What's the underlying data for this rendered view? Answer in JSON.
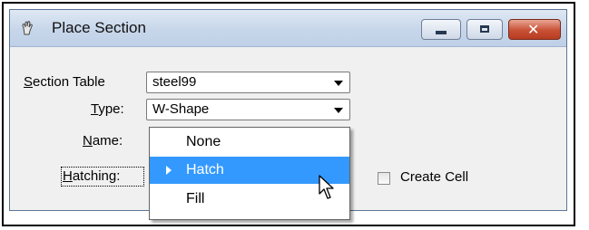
{
  "window": {
    "title": "Place Section",
    "app_icon": "hand-icon",
    "buttons": {
      "minimize_icon": "minimize-icon",
      "maximize_icon": "maximize-icon",
      "close_label": "✕"
    }
  },
  "form": {
    "section_table": {
      "label_mnemonic": "S",
      "label_rest": "ection Table",
      "value": "steel99"
    },
    "type": {
      "label_mnemonic": "T",
      "label_rest": "ype:",
      "value": "W-Shape"
    },
    "name": {
      "label_mnemonic": "N",
      "label_rest": "ame:"
    },
    "hatching": {
      "label_mnemonic": "H",
      "label_rest": "atching:"
    },
    "create_cell": {
      "label": "Create Cell",
      "checked": false
    }
  },
  "dropdown": {
    "options": [
      "None",
      "Hatch",
      "Fill"
    ],
    "selected": "Hatch"
  },
  "colors": {
    "selection": "#3399ff",
    "title_bar": "#c7d6ea",
    "close_button": "#c85035"
  }
}
